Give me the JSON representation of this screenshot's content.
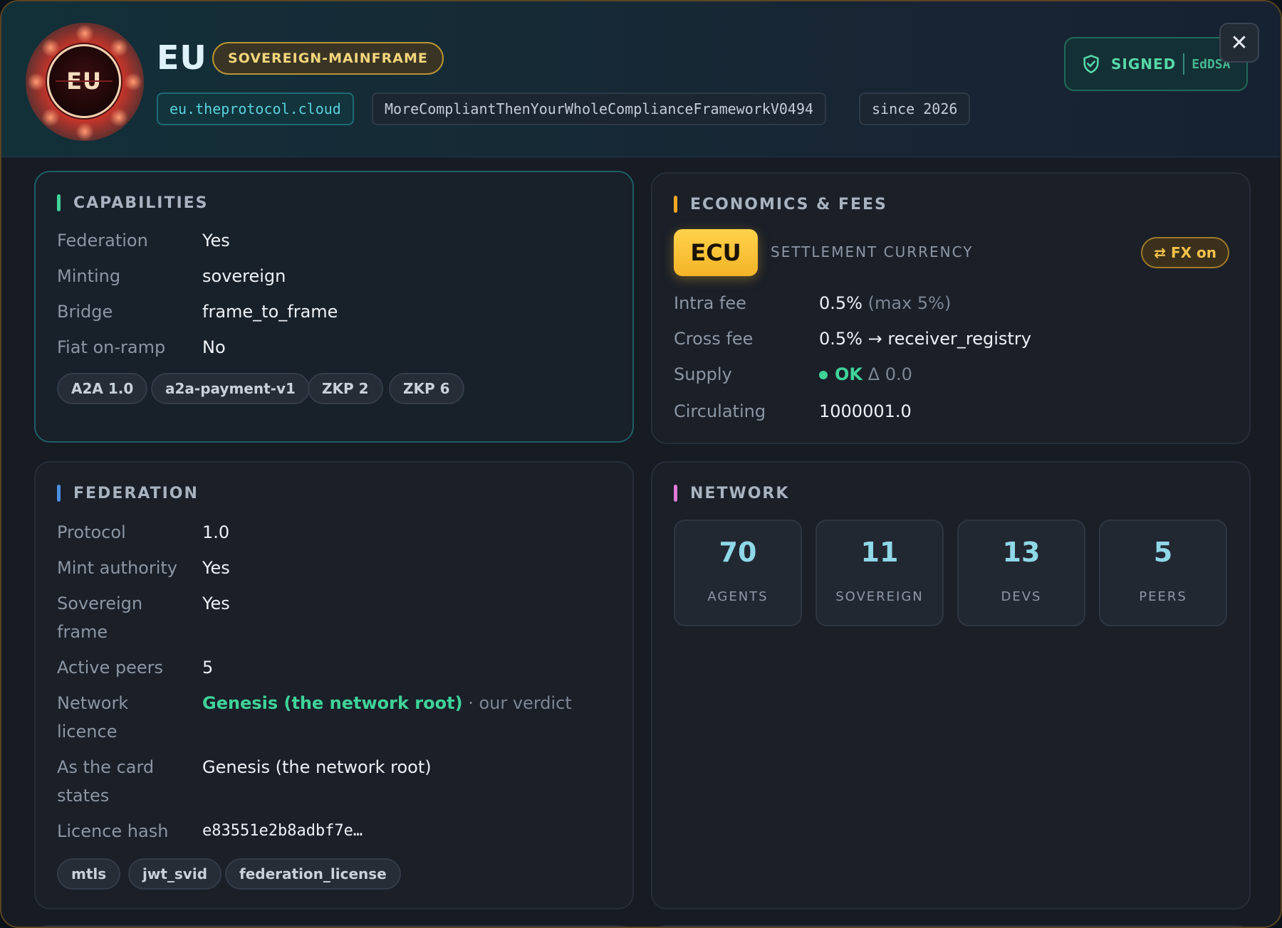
{
  "header": {
    "emblem_text": "EU",
    "node_name": "EU",
    "tier_badge": "SOVEREIGN-MAINFRAME",
    "host": "eu.theprotocol.cloud",
    "version_tag": "MoreCompliantThenYourWholeComplianceFrameworkV0494",
    "since": "since 2026",
    "signed_label": "SIGNED",
    "signed_alg": "EdDSA",
    "close_symbol": "✕",
    "accent_color": "#56d8a8"
  },
  "capabilities": {
    "title": "CAPABILITIES",
    "bar_color": "#3fd39a",
    "rows": [
      {
        "k": "Federation",
        "v": "Yes"
      },
      {
        "k": "Minting",
        "v": "sovereign"
      },
      {
        "k": "Bridge",
        "v": "frame_to_frame"
      },
      {
        "k": "Fiat on-ramp",
        "v": "No"
      }
    ],
    "tags": [
      "A2A 1.0",
      "a2a-payment-v1",
      "ZKP 2",
      "ZKP 6"
    ]
  },
  "economics": {
    "title": "ECONOMICS & FEES",
    "bar_color": "#f4a623",
    "currency": "ECU",
    "currency_caption": "SETTLEMENT CURRENCY",
    "fx_label": "⇄ FX on",
    "intra_fee_label": "Intra fee",
    "intra_fee_value": "0.5%",
    "intra_fee_max": "(max 5%)",
    "cross_fee_label": "Cross fee",
    "cross_fee_value": "0.5% → receiver_registry",
    "supply_label": "Supply",
    "supply_status": "OK",
    "supply_delta": "Δ 0.0",
    "circulating_label": "Circulating",
    "circulating_value": "1000001.0"
  },
  "federation": {
    "title": "FEDERATION",
    "bar_color": "#4a90e2",
    "protocol_label": "Protocol",
    "protocol_value": "1.0",
    "mint_label": "Mint authority",
    "mint_value": "Yes",
    "sovereign_label_1": "Sovereign",
    "sovereign_label_2": "frame",
    "sovereign_value": "Yes",
    "peers_label": "Active peers",
    "peers_value": "5",
    "licence_label_1": "Network",
    "licence_label_2": "licence",
    "licence_value": "Genesis (the network root)",
    "licence_note": "· our verdict",
    "card_label_1": "As the card",
    "card_label_2": "states",
    "card_value": "Genesis (the network root)",
    "hash_label": "Licence hash",
    "hash_value": "e83551e2b8adbf7e…",
    "tags": [
      "mtls",
      "jwt_svid",
      "federation_license"
    ]
  },
  "network": {
    "title": "NETWORK",
    "bar_color": "#e07ad8",
    "stats": [
      {
        "num": "70",
        "label": "AGENTS"
      },
      {
        "num": "11",
        "label": "SOVEREIGN"
      },
      {
        "num": "13",
        "label": "DEVS"
      },
      {
        "num": "5",
        "label": "PEERS"
      }
    ]
  }
}
